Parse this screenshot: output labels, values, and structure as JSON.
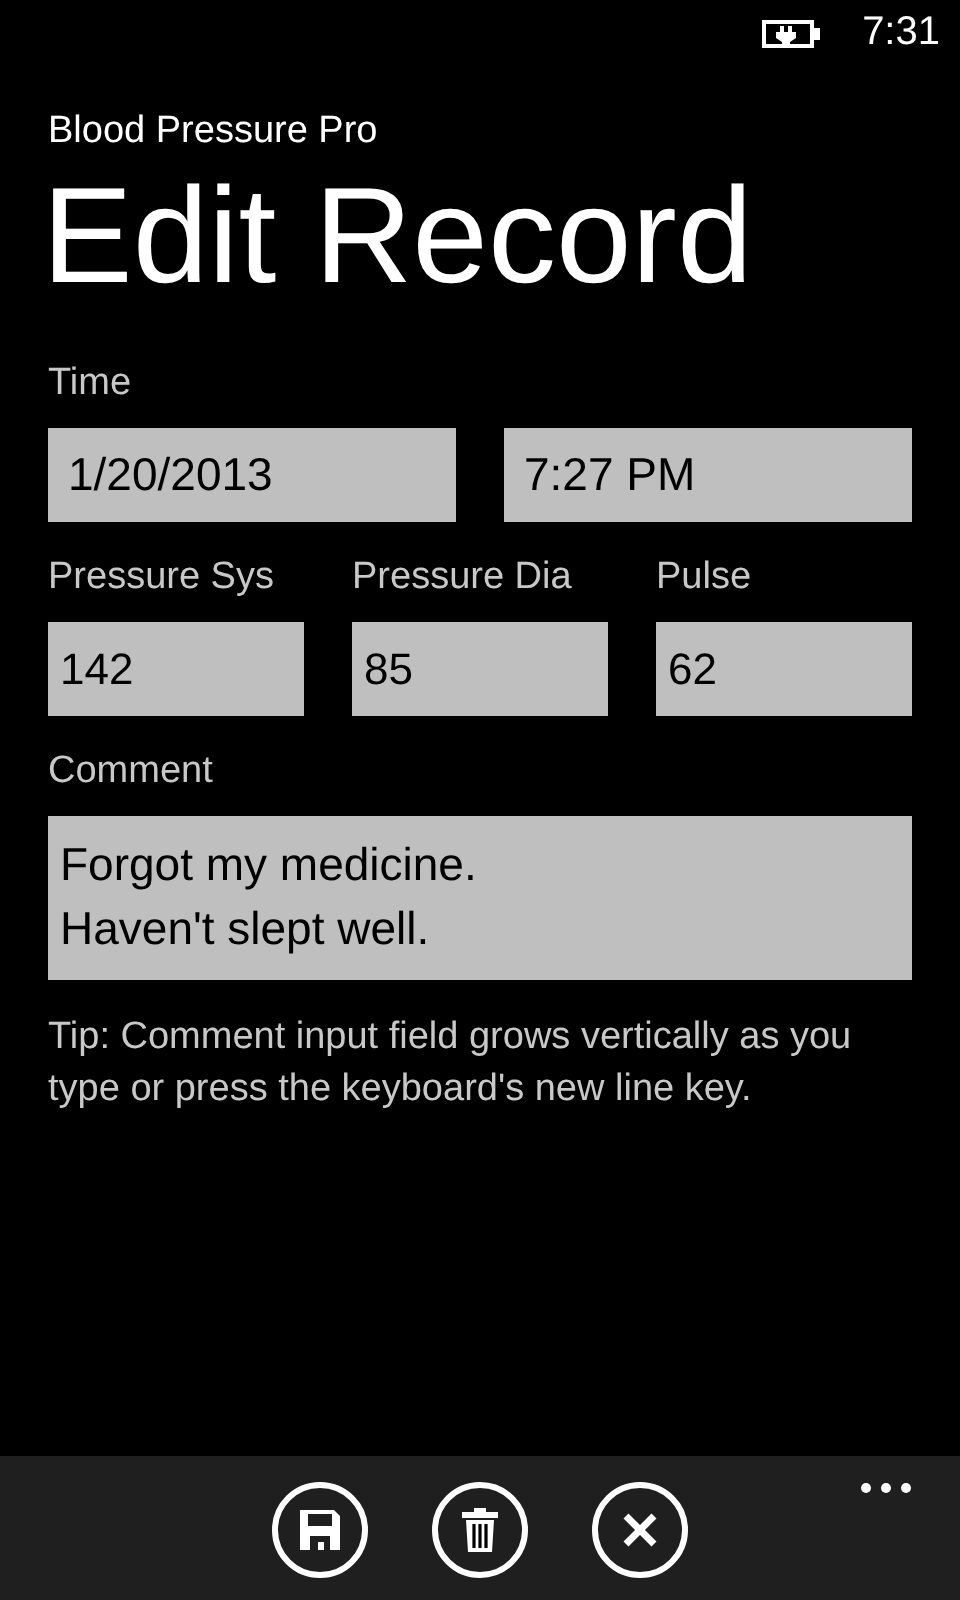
{
  "status_bar": {
    "time": "7:31"
  },
  "app_title": "Blood Pressure Pro",
  "page_title": "Edit Record",
  "time_section": {
    "label": "Time",
    "date": "1/20/2013",
    "time": "7:27 PM"
  },
  "measurements": [
    {
      "label": "Pressure Sys",
      "value": "142"
    },
    {
      "label": "Pressure Dia",
      "value": "85"
    },
    {
      "label": "Pulse",
      "value": "62"
    }
  ],
  "comment": {
    "label": "Comment",
    "value": "Forgot my medicine.\nHaven't slept well."
  },
  "tip": "Tip: Comment input field grows vertically as you type or press the keyboard's new line key.",
  "app_bar": {
    "buttons": [
      {
        "kind": "save"
      },
      {
        "kind": "delete"
      },
      {
        "kind": "cancel"
      }
    ]
  }
}
